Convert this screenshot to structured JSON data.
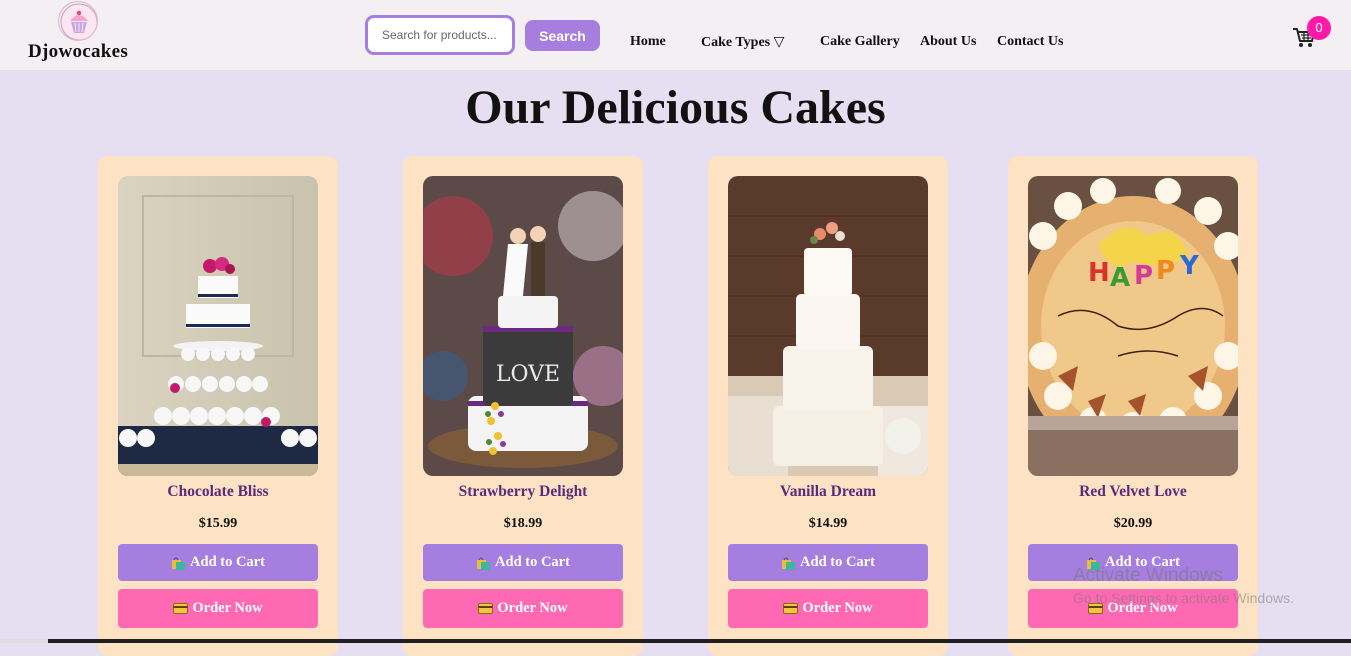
{
  "header": {
    "brand": "Djowocakes",
    "search": {
      "placeholder": "Search for products...",
      "button_label": "Search"
    },
    "nav": {
      "home": "Home",
      "cake_types": "Cake Types ▽",
      "cake_gallery": "Cake Gallery",
      "about": "About Us",
      "contact": "Contact Us"
    },
    "cart": {
      "icon": "shopping-cart-icon",
      "count": "0"
    }
  },
  "main": {
    "title": "Our Delicious Cakes",
    "products": [
      {
        "name": "Chocolate Bliss",
        "price": "$15.99",
        "add_label": "Add to Cart",
        "order_label": "Order Now"
      },
      {
        "name": "Strawberry Delight",
        "price": "$18.99",
        "add_label": "Add to Cart",
        "order_label": "Order Now"
      },
      {
        "name": "Vanilla Dream",
        "price": "$14.99",
        "add_label": "Add to Cart",
        "order_label": "Order Now"
      },
      {
        "name": "Red Velvet Love",
        "price": "$20.99",
        "add_label": "Add to Cart",
        "order_label": "Order Now"
      }
    ]
  },
  "overlay": {
    "watermark_title": "Activate Windows",
    "watermark_sub": "Go to Settings to activate Windows."
  },
  "colors": {
    "page_bg": "#e6dff1",
    "header_bg": "#f3eff2",
    "accent_purple": "#a57ee0",
    "accent_pink": "#ff69b4",
    "card_bg": "#fee2c4",
    "badge": "#ff1aa7",
    "product_name": "#5b2a7a"
  }
}
